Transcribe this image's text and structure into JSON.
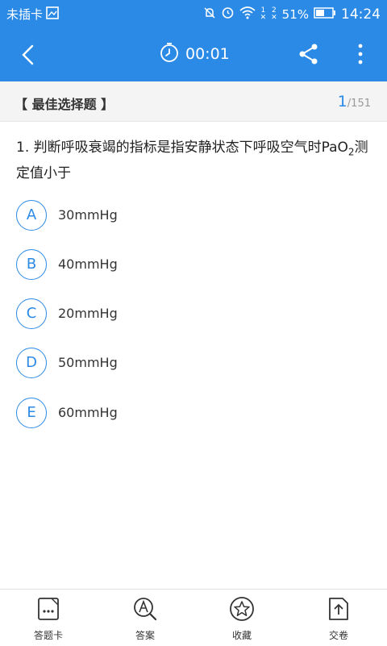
{
  "status_bar": {
    "carrier": "未插卡",
    "battery_percent": "51%",
    "time": "14:24",
    "sim1": "1",
    "sim2": "2",
    "icons": [
      "image-icon",
      "mute-icon",
      "alarm-icon",
      "wifi-icon",
      "signal-icon",
      "battery-icon"
    ]
  },
  "toolbar": {
    "timer": "00:01",
    "icons": [
      "back-arrow-icon",
      "timer-icon",
      "share-icon",
      "more-icon"
    ]
  },
  "question_type": {
    "label": "【 最佳选择题 】",
    "current": "1",
    "total": "/151"
  },
  "question": {
    "text_before": "1. 判断呼吸衰竭的指标是指安静状态下呼吸空气时PaO",
    "subscript": "2",
    "text_after": "测定值小于"
  },
  "options": [
    {
      "letter": "A",
      "text": "30mmHg"
    },
    {
      "letter": "B",
      "text": "40mmHg"
    },
    {
      "letter": "C",
      "text": "20mmHg"
    },
    {
      "letter": "D",
      "text": "50mmHg"
    },
    {
      "letter": "E",
      "text": "60mmHg"
    }
  ],
  "bottom_tabs": [
    {
      "label": "答题卡",
      "icon": "answer-sheet-icon"
    },
    {
      "label": "答案",
      "icon": "answer-search-icon"
    },
    {
      "label": "收藏",
      "icon": "star-icon"
    },
    {
      "label": "交卷",
      "icon": "submit-icon"
    }
  ],
  "colors": {
    "accent": "#2b8ae6",
    "background": "#ffffff",
    "header_bg": "#f4f4f4"
  }
}
